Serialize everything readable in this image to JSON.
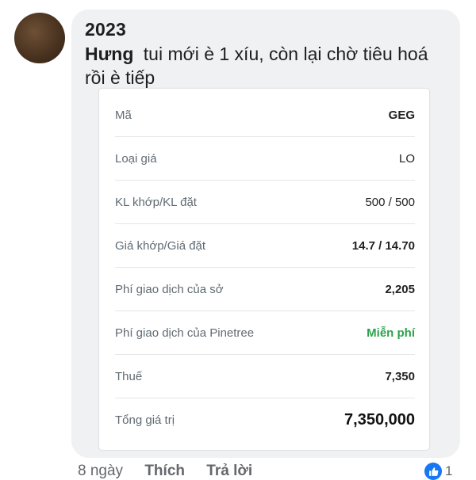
{
  "comment": {
    "header": "2023",
    "author": "Hưng",
    "text": "tui mới è 1 xíu, còn lại chờ tiêu hoá rồi è tiếp"
  },
  "order_card": {
    "rows": [
      {
        "label": "Mã",
        "value": "GEG"
      },
      {
        "label": "Loại giá",
        "value": "LO"
      },
      {
        "label": "KL khớp/KL đặt",
        "value": "500 / 500"
      },
      {
        "label": "Giá khớp/Giá đặt",
        "value": "14.7 / 14.70"
      },
      {
        "label": "Phí giao dịch của sở",
        "value": "2,205"
      },
      {
        "label": "Phí giao dịch của Pinetree",
        "value": "Miễn phí"
      },
      {
        "label": "Thuế",
        "value": "7,350"
      },
      {
        "label": "Tổng giá trị",
        "value": "7,350,000"
      }
    ]
  },
  "actions": {
    "time": "8 ngày",
    "like_label": "Thích",
    "reply_label": "Trả lời"
  },
  "reactions": {
    "icon": "thumbs-up-icon",
    "count": "1",
    "color": "#1877f2"
  },
  "colors": {
    "free_fee": "#2ca24c",
    "bubble": "#eff1f3"
  }
}
